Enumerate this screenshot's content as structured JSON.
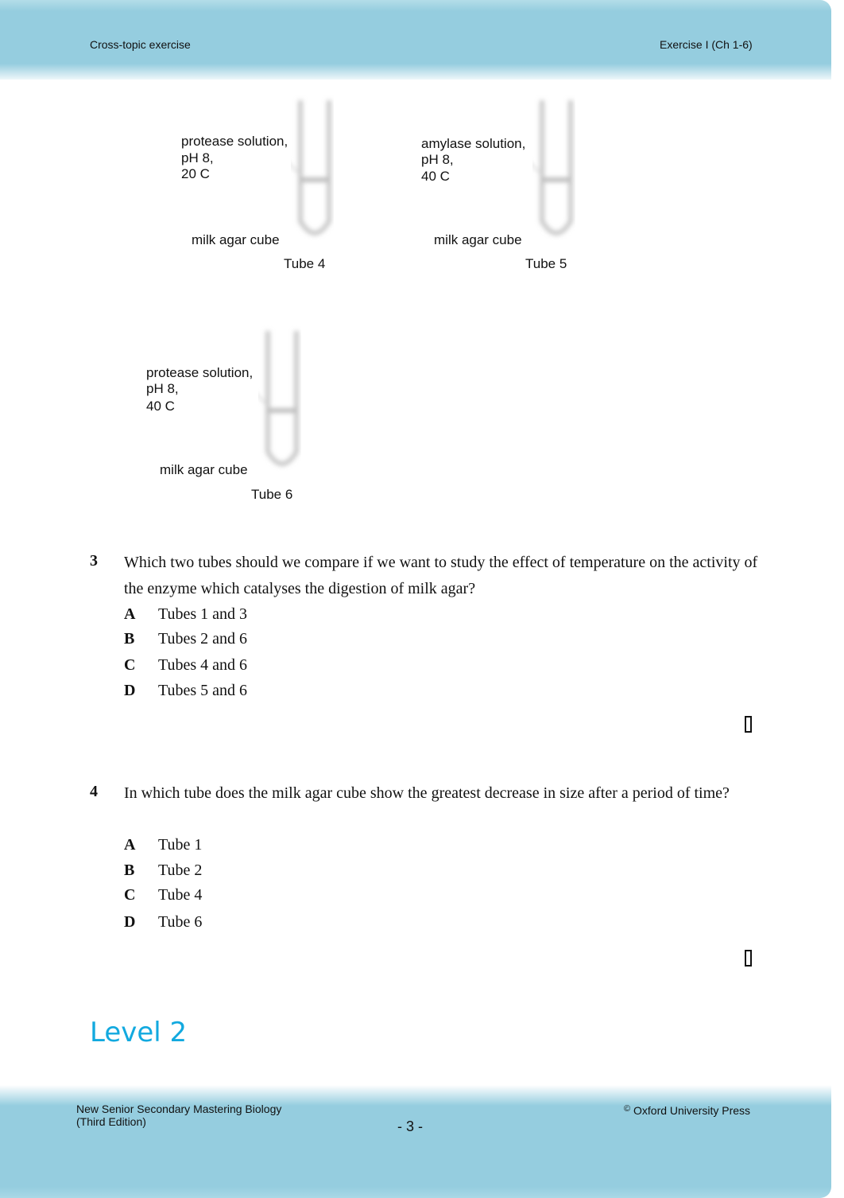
{
  "header": {
    "left": "Cross-topic exercise",
    "right": "Exercise I (Ch 1-6)"
  },
  "figures": [
    {
      "solution": "protease solution,",
      "ph": "pH 8,",
      "temp": "20 C",
      "cube": "milk agar cube",
      "caption": "Tube 4"
    },
    {
      "solution": "amylase solution,",
      "ph": "pH 8,",
      "temp": "40 C",
      "cube": "milk agar cube",
      "caption": "Tube 5"
    },
    {
      "solution": "protease solution,",
      "ph": "pH 8,",
      "temp": "40 C",
      "cube": "milk agar cube",
      "caption": "Tube 6"
    }
  ],
  "questions": [
    {
      "number": "3",
      "text": "Which two tubes should we compare if we want to study the effect of temperature on the activity of the enzyme which catalyses the digestion of milk agar?",
      "options": [
        {
          "letter": "A",
          "text": "Tubes 1 and 3"
        },
        {
          "letter": "B",
          "text": "Tubes 2 and 6"
        },
        {
          "letter": "C",
          "text": "Tubes 4 and 6"
        },
        {
          "letter": "D",
          "text": "Tubes 5 and 6"
        }
      ]
    },
    {
      "number": "4",
      "text": "In which tube does the milk agar cube show the greatest decrease in size after a period of time?",
      "options": [
        {
          "letter": "A",
          "text": "Tube 1"
        },
        {
          "letter": "B",
          "text": "Tube 2"
        },
        {
          "letter": "C",
          "text": "Tube 4"
        },
        {
          "letter": "D",
          "text": "Tube 6"
        }
      ]
    }
  ],
  "section_heading": "Level 2",
  "footer": {
    "book_title": "New Senior Secondary Mastering Biology",
    "edition": "(Third Edition)",
    "page": "- 3 -",
    "copyright_symbol": "©",
    "publisher": "Oxford University Press"
  },
  "colors": {
    "band": "#95cddf",
    "heading": "#12a9df"
  }
}
